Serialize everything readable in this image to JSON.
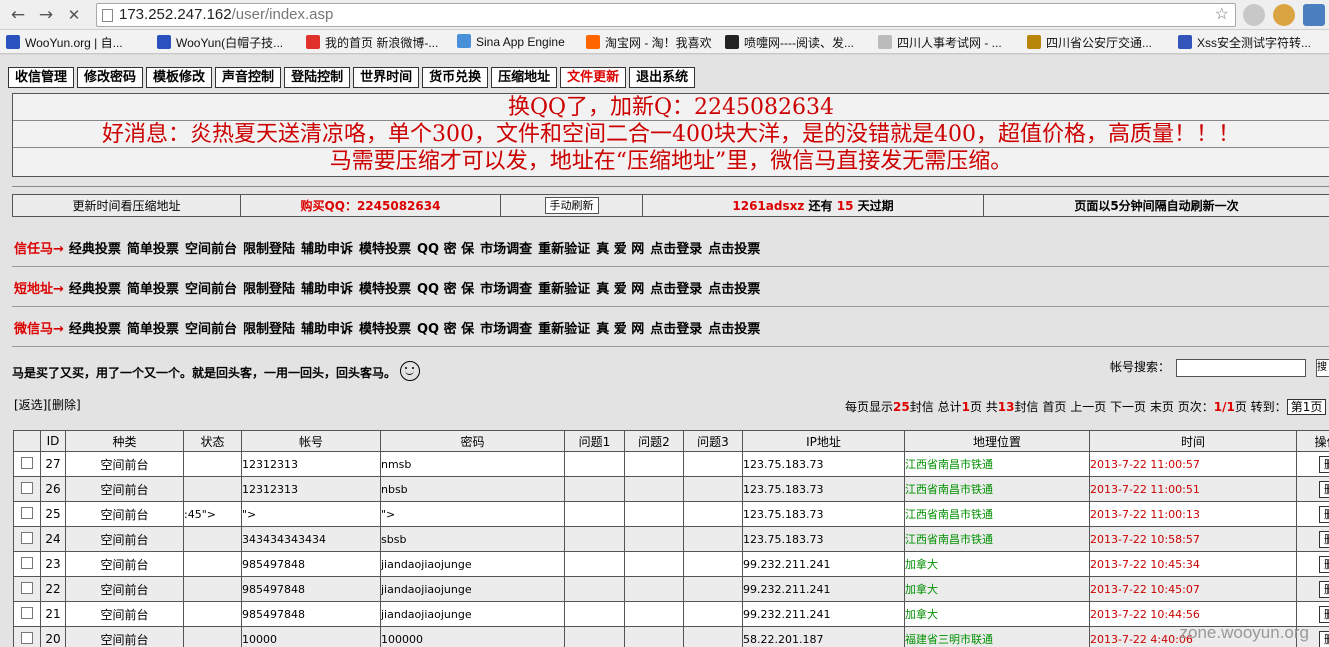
{
  "browser": {
    "url_host": "173.252.247.162",
    "url_path": "/user/index.asp",
    "bookmarks": [
      {
        "label": "WooYun.org | 自...",
        "color": "#2a52be"
      },
      {
        "label": "WooYun(白帽子技...",
        "color": "#2a52be"
      },
      {
        "label": "我的首页 新浪微博-...",
        "color": "#e0302a"
      },
      {
        "label": "Sina App Engine",
        "color": "#4a90d9"
      },
      {
        "label": "淘宝网 - 淘！我喜欢",
        "color": "#ff6600"
      },
      {
        "label": "喷嚏网----阅读、发...",
        "color": "#222222"
      },
      {
        "label": "四川人事考试网 - ...",
        "color": "#bbbbbb"
      },
      {
        "label": "四川省公安厅交通...",
        "color": "#b8860b"
      },
      {
        "label": "Xss安全测试字符转...",
        "color": "#3355bb"
      }
    ]
  },
  "menu": [
    {
      "label": "收信管理",
      "active": false
    },
    {
      "label": "修改密码",
      "active": false
    },
    {
      "label": "模板修改",
      "active": false
    },
    {
      "label": "声音控制",
      "active": false
    },
    {
      "label": "登陆控制",
      "active": false
    },
    {
      "label": "世界时间",
      "active": false
    },
    {
      "label": "货币兑换",
      "active": false
    },
    {
      "label": "压缩地址",
      "active": false
    },
    {
      "label": "文件更新",
      "active": true
    },
    {
      "label": "退出系统",
      "active": false
    }
  ],
  "notice": {
    "line1": "换QQ了，加新Q：2245082634",
    "line2": "好消息：炎热夏天送清凉咯，单个300，文件和空间二合一400块大洋，是的没错就是400，超值价格，高质量！！！",
    "line3": "马需要压缩才可以发，地址在“压缩地址”里，微信马直接发无需压缩。"
  },
  "info": {
    "update_hint": "更新时间看压缩地址",
    "buy_qq": "购买QQ：2245082634",
    "refresh_button": "手动刷新",
    "user": "1261adsxz",
    "remain_label": "还有",
    "days": "15",
    "expire_label": "天过期",
    "auto_refresh": "页面以5分钟间隔自动刷新一次"
  },
  "link_rows": [
    {
      "label": "信任马→",
      "links": [
        "经典投票",
        "简单投票",
        "空间前台",
        "限制登陆",
        "辅助申诉",
        "模特投票",
        "QQ 密 保",
        "市场调查",
        "重新验证",
        "真 爱 网",
        "点击登录",
        "点击投票"
      ]
    },
    {
      "label": "短地址→",
      "links": [
        "经典投票",
        "简单投票",
        "空间前台",
        "限制登陆",
        "辅助申诉",
        "模特投票",
        "QQ 密 保",
        "市场调查",
        "重新验证",
        "真 爱 网",
        "点击登录",
        "点击投票"
      ]
    },
    {
      "label": "微信马→",
      "links": [
        "经典投票",
        "简单投票",
        "空间前台",
        "限制登陆",
        "辅助申诉",
        "模特投票",
        "QQ 密 保",
        "市场调查",
        "重新验证",
        "真 爱 网",
        "点击登录",
        "点击投票"
      ]
    }
  ],
  "slogan": "马是买了又买，用了一个又一个。就是回头客，一用一回头，回头客马。",
  "search": {
    "label": "帐号搜索：",
    "value": "",
    "button": "搜"
  },
  "actions": {
    "invert": "[返选]",
    "delete": "[删除]"
  },
  "pager": {
    "per_page_prefix": "每页显示",
    "per_page": "25",
    "per_page_suffix": "封信",
    "total_prefix": "总计",
    "total_pages": "1",
    "total_pages_suffix": "页",
    "total_mail_prefix": "共",
    "total_mail": "13",
    "total_mail_suffix": "封信",
    "first": "首页",
    "prev": "上一页",
    "next": "下一页",
    "last": "末页",
    "page_label": "页次：",
    "page_current": "1/1",
    "page_suffix": "页",
    "goto_label": "转到：",
    "goto_value": "第1页"
  },
  "table": {
    "headers": [
      "",
      "ID",
      "种类",
      "状态",
      "帐号",
      "密码",
      "问题1",
      "问题2",
      "问题3",
      "IP地址",
      "地理位置",
      "时间",
      "操作"
    ],
    "delete_label": "删除",
    "rows": [
      {
        "id": "27",
        "kind": "空间前台",
        "status": "",
        "account": "12312313",
        "password": "nmsb",
        "q1": "",
        "q2": "",
        "q3": "",
        "ip": "123.75.183.73",
        "geo": "江西省南昌市铁通",
        "time": "2013-7-22 11:00:57"
      },
      {
        "id": "26",
        "kind": "空间前台",
        "status": "",
        "account": "12312313",
        "password": "nbsb",
        "q1": "",
        "q2": "",
        "q3": "",
        "ip": "123.75.183.73",
        "geo": "江西省南昌市铁通",
        "time": "2013-7-22 11:00:51"
      },
      {
        "id": "25",
        "kind": "空间前台",
        "status": ":45\">",
        "account": "\">",
        "password": "\">",
        "q1": "",
        "q2": "",
        "q3": "",
        "ip": "123.75.183.73",
        "geo": "江西省南昌市铁通",
        "time": "2013-7-22 11:00:13"
      },
      {
        "id": "24",
        "kind": "空间前台",
        "status": "",
        "account": "343434343434",
        "password": "sbsb",
        "q1": "",
        "q2": "",
        "q3": "",
        "ip": "123.75.183.73",
        "geo": "江西省南昌市铁通",
        "time": "2013-7-22 10:58:57"
      },
      {
        "id": "23",
        "kind": "空间前台",
        "status": "",
        "account": "985497848",
        "password": "jiandaojiaojunge",
        "q1": "",
        "q2": "",
        "q3": "",
        "ip": "99.232.211.241",
        "geo": "加拿大",
        "time": "2013-7-22 10:45:34"
      },
      {
        "id": "22",
        "kind": "空间前台",
        "status": "",
        "account": "985497848",
        "password": "jiandaojiaojunge",
        "q1": "",
        "q2": "",
        "q3": "",
        "ip": "99.232.211.241",
        "geo": "加拿大",
        "time": "2013-7-22 10:45:07"
      },
      {
        "id": "21",
        "kind": "空间前台",
        "status": "",
        "account": "985497848",
        "password": "jiandaojiaojunge",
        "q1": "",
        "q2": "",
        "q3": "",
        "ip": "99.232.211.241",
        "geo": "加拿大",
        "time": "2013-7-22 10:44:56"
      },
      {
        "id": "20",
        "kind": "空间前台",
        "status": "",
        "account": "10000",
        "password": "100000",
        "q1": "",
        "q2": "",
        "q3": "",
        "ip": "58.22.201.187",
        "geo": "福建省三明市联通",
        "time": "2013-7-22 4:40:06"
      }
    ]
  },
  "watermark": "zone.wooyun.org"
}
